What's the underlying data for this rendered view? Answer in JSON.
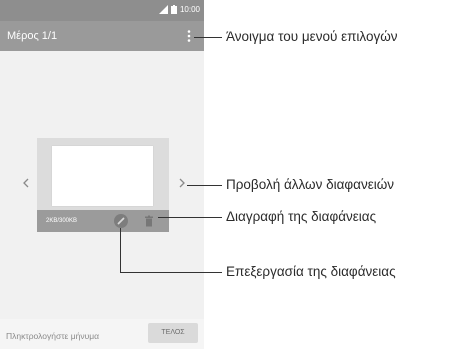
{
  "status_bar": {
    "time": "10:00"
  },
  "app_bar": {
    "title": "Μέρος 1/1"
  },
  "slide": {
    "size": "2KB/300KB"
  },
  "compose": {
    "placeholder": "Πληκτρολογήστε μήνυμα",
    "end_button": "ΤΕΛΟΣ"
  },
  "callouts": {
    "menu": "Άνοιγμα του μενού επιλογών",
    "view_other": "Προβολή άλλων διαφανειών",
    "delete": "Διαγραφή της διαφάνειας",
    "edit": "Επεξεργασία της διαφάνειας"
  },
  "icons": {
    "overflow": "more-vert-icon",
    "prev": "chevron-left-icon",
    "next": "chevron-right-icon",
    "edit": "pencil-icon",
    "delete": "trash-icon",
    "signal": "signal-icon",
    "battery": "battery-icon"
  },
  "colors": {
    "app_bar": "#9a9a9a",
    "status_bar": "#8e8e8e",
    "background": "#f1f1f1"
  }
}
